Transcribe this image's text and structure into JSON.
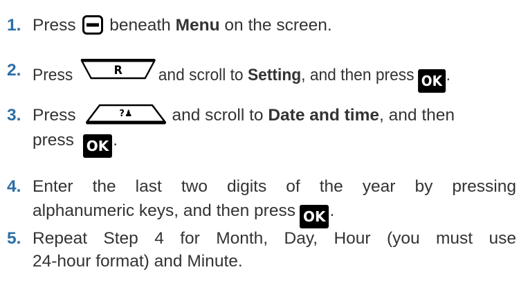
{
  "steps": [
    {
      "number": "1.",
      "before": "Press",
      "icon": "menu-softkey-icon",
      "after_a": "beneath",
      "bold": "Menu",
      "after_b": "on the screen."
    },
    {
      "number": "2.",
      "before": "Press",
      "icon": "scroll-down-key-icon",
      "key_label": "R",
      "after_a": "and scroll to",
      "bold": "Setting",
      "after_b": ", and then press",
      "ok_label": "OK",
      "end": "."
    },
    {
      "number": "3.",
      "before": "Press",
      "icon": "scroll-up-key-icon",
      "key_label": "?♟",
      "after_a": "and scroll to",
      "bold": "Date and time",
      "after_b": ", and then",
      "line2": "press",
      "ok_label": "OK",
      "end": "."
    },
    {
      "number": "4.",
      "line1": "Enter the last two digits of the year by pressing",
      "line2": "alphanumeric keys, and then press",
      "ok_label": "OK",
      "end": "."
    },
    {
      "number": "5.",
      "line1": "Repeat Step 4 for Month, Day, Hour (you must use",
      "line2": "24-hour format) and Minute."
    }
  ],
  "colors": {
    "step_number": "#2b6ea6",
    "text": "#333333",
    "ok_background": "#000000",
    "ok_text": "#ffffff"
  }
}
